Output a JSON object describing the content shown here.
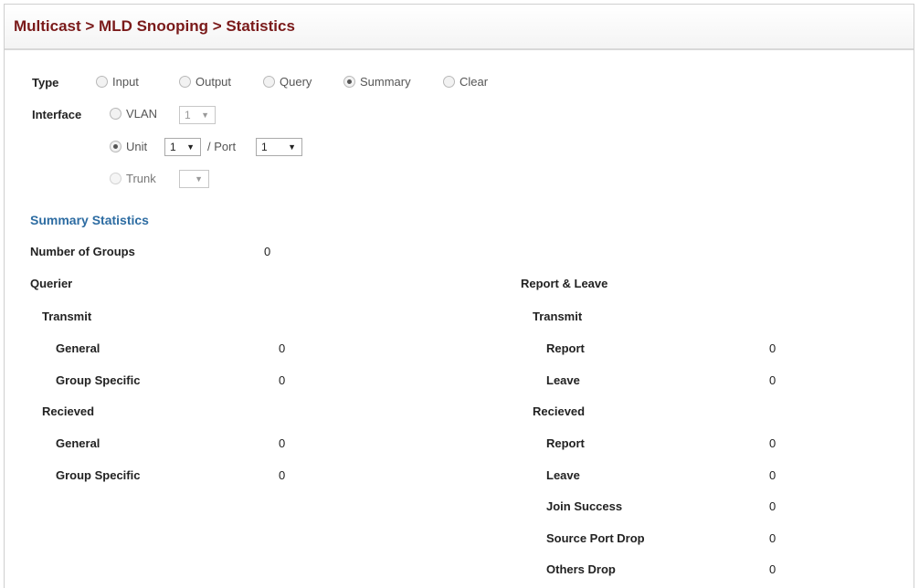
{
  "header": {
    "title": "Multicast > MLD Snooping > Statistics"
  },
  "type": {
    "label": "Type",
    "options": [
      "Input",
      "Output",
      "Query",
      "Summary",
      "Clear"
    ],
    "selected": "Summary"
  },
  "interface": {
    "label": "Interface",
    "vlan_label": "VLAN",
    "vlan_value": "1",
    "unit_label": "Unit",
    "unit_value": "1",
    "port_sep": "/ Port",
    "port_value": "1",
    "trunk_label": "Trunk",
    "trunk_value": "",
    "selected": "Unit"
  },
  "summary": {
    "heading": "Summary Statistics",
    "groups_label": "Number of Groups",
    "groups_value": "0",
    "querier": {
      "heading": "Querier",
      "transmit": "Transmit",
      "tx_general": "General",
      "tx_general_value": "0",
      "tx_group": "Group Specific",
      "tx_group_value": "0",
      "received": "Recieved",
      "rx_general": "General",
      "rx_general_value": "0",
      "rx_group": "Group Specific",
      "rx_group_value": "0"
    },
    "report_leave": {
      "heading": "Report & Leave",
      "transmit": "Transmit",
      "tx_report": "Report",
      "tx_report_value": "0",
      "tx_leave": "Leave",
      "tx_leave_value": "0",
      "received": "Recieved",
      "rx_report": "Report",
      "rx_report_value": "0",
      "rx_leave": "Leave",
      "rx_leave_value": "0",
      "rx_join": "Join Success",
      "rx_join_value": "0",
      "rx_srcdrop": "Source Port Drop",
      "rx_srcdrop_value": "0",
      "rx_otherdrop": "Others Drop",
      "rx_otherdrop_value": "0"
    }
  },
  "icons": {
    "dropdown_arrow": "▼"
  }
}
